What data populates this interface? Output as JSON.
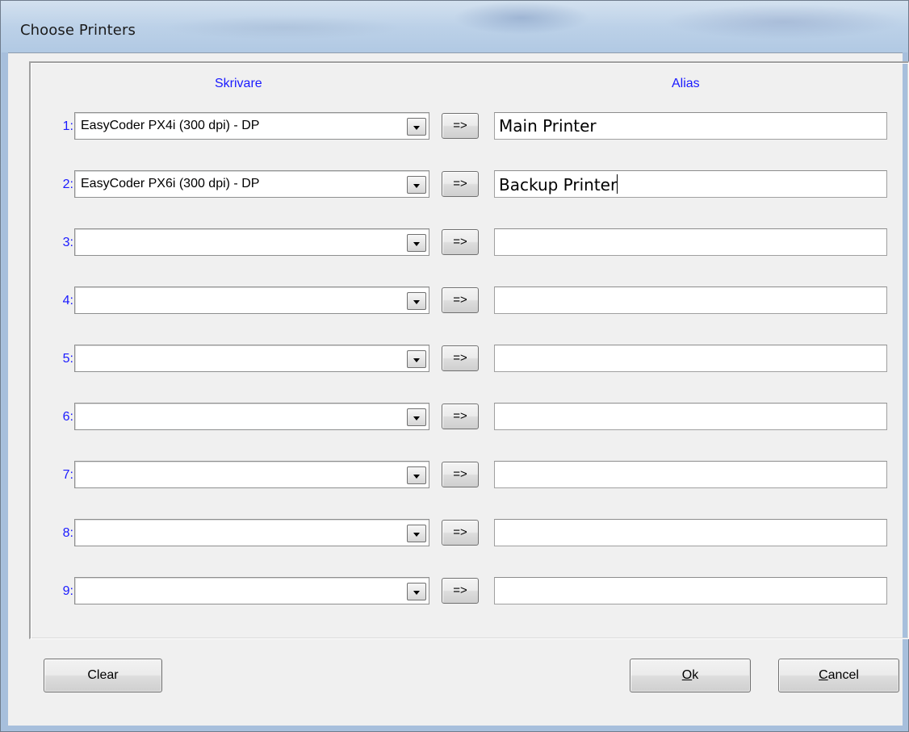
{
  "window": {
    "title": "Choose Printers"
  },
  "headers": {
    "printer": "Skrivare",
    "alias": "Alias"
  },
  "copy_button_label": "=>",
  "rows": [
    {
      "number": "1:",
      "printer": "EasyCoder PX4i (300 dpi) - DP",
      "alias": "Main Printer"
    },
    {
      "number": "2:",
      "printer": "EasyCoder PX6i (300 dpi) - DP",
      "alias": "Backup Printer"
    },
    {
      "number": "3:",
      "printer": "",
      "alias": ""
    },
    {
      "number": "4:",
      "printer": "",
      "alias": ""
    },
    {
      "number": "5:",
      "printer": "",
      "alias": ""
    },
    {
      "number": "6:",
      "printer": "",
      "alias": ""
    },
    {
      "number": "7:",
      "printer": "",
      "alias": ""
    },
    {
      "number": "8:",
      "printer": "",
      "alias": ""
    },
    {
      "number": "9:",
      "printer": "",
      "alias": ""
    }
  ],
  "buttons": {
    "clear": "Clear",
    "ok_mnemonic": "O",
    "ok_rest": "k",
    "cancel_mnemonic": "C",
    "cancel_rest": "ancel"
  },
  "colors": {
    "label_blue": "#1a1aff",
    "dialog_face": "#f0f0f0"
  }
}
